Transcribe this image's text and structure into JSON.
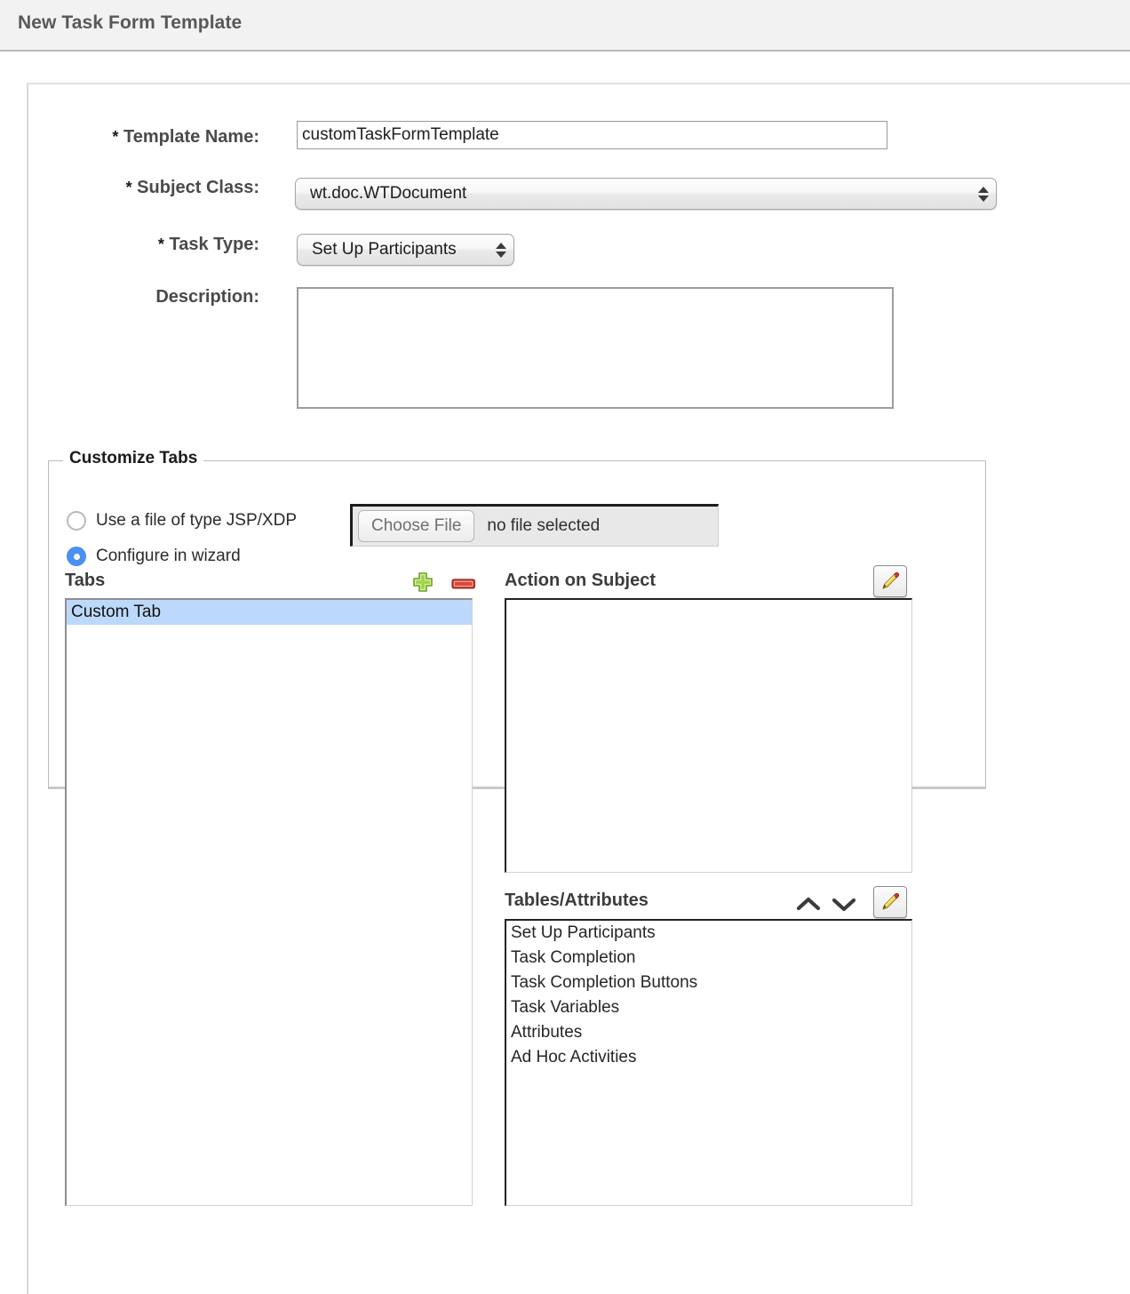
{
  "header": {
    "title": "New Task Form Template"
  },
  "form": {
    "template_name": {
      "label": "Template Name:",
      "required_marker": "*",
      "value": "customTaskFormTemplate"
    },
    "subject_class": {
      "label": "Subject Class:",
      "required_marker": "*",
      "value": "wt.doc.WTDocument"
    },
    "task_type": {
      "label": "Task Type:",
      "required_marker": "*",
      "value": "Set Up Participants"
    },
    "description": {
      "label": "Description:",
      "value": ""
    }
  },
  "customize_tabs": {
    "legend": "Customize Tabs",
    "source_options": [
      {
        "label": "Use a file of type JSP/XDP",
        "selected": false
      },
      {
        "label": "Configure in wizard",
        "selected": true
      }
    ],
    "file_input": {
      "button_label": "Choose File",
      "status": "no file selected"
    },
    "tabs_panel": {
      "title": "Tabs",
      "add_icon": "plus-icon",
      "remove_icon": "minus-icon",
      "items": [
        {
          "label": "Custom Tab",
          "selected": true
        }
      ]
    },
    "action_on_subject_panel": {
      "title": "Action on Subject",
      "edit_icon": "pencil-icon",
      "items": []
    },
    "tables_attributes_panel": {
      "title": "Tables/Attributes",
      "move_up_icon": "chevron-up-icon",
      "move_down_icon": "chevron-down-icon",
      "edit_icon": "pencil-icon",
      "items": [
        "Set Up Participants",
        "Task Completion",
        "Task Completion Buttons",
        "Task Variables",
        "Attributes",
        "Ad Hoc Activities"
      ]
    }
  },
  "colors": {
    "header_bg": "#f2f2f2",
    "header_text": "#57585a",
    "selection_blue": "#bcd9fb",
    "radio_blue": "#4a90f0",
    "add_green": "#8cc63f",
    "remove_red": "#cc3b32",
    "pencil_yellow": "#f2c744"
  }
}
